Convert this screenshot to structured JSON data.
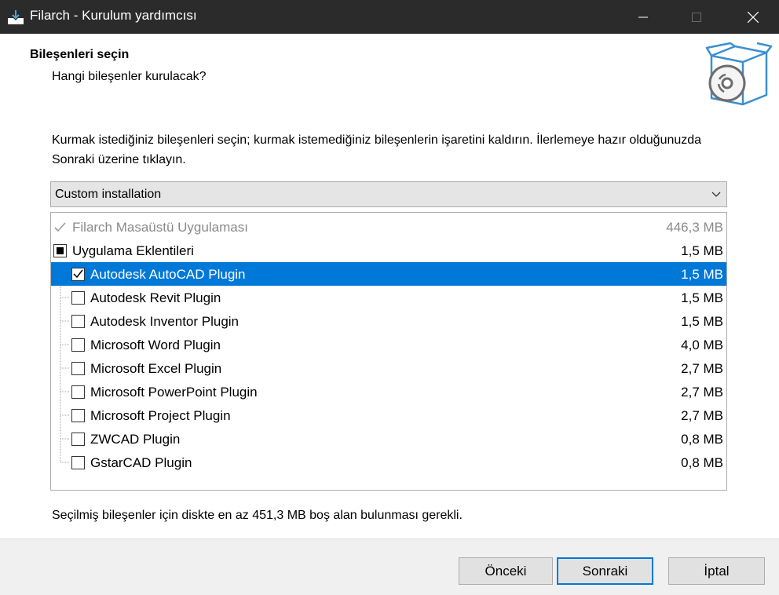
{
  "window": {
    "title": "Filarch - Kurulum yardımcısı"
  },
  "header": {
    "title": "Bileşenleri seçin",
    "subtitle": "Hangi bileşenler kurulacak?"
  },
  "description": "Kurmak istediğiniz bileşenleri seçin; kurmak istemediğiniz bileşenlerin işaretini kaldırın. İlerlemeye hazır olduğunuzda Sonraki üzerine tıklayın.",
  "install_type": {
    "selected": "Custom installation"
  },
  "components": [
    {
      "label": "Filarch Masaüstü Uygulaması",
      "size": "446,3 MB",
      "state": "checked-disabled"
    },
    {
      "label": "Uygulama Eklentileri",
      "size": "1,5 MB",
      "state": "partial"
    },
    {
      "label": "Autodesk AutoCAD Plugin",
      "size": "1,5 MB",
      "state": "checked"
    },
    {
      "label": "Autodesk Revit Plugin",
      "size": "1,5 MB",
      "state": "unchecked"
    },
    {
      "label": "Autodesk Inventor Plugin",
      "size": "1,5 MB",
      "state": "unchecked"
    },
    {
      "label": "Microsoft Word Plugin",
      "size": "4,0 MB",
      "state": "unchecked"
    },
    {
      "label": "Microsoft Excel Plugin",
      "size": "2,7 MB",
      "state": "unchecked"
    },
    {
      "label": "Microsoft PowerPoint Plugin",
      "size": "2,7 MB",
      "state": "unchecked"
    },
    {
      "label": "Microsoft Project Plugin",
      "size": "2,7 MB",
      "state": "unchecked"
    },
    {
      "label": "ZWCAD Plugin",
      "size": "0,8 MB",
      "state": "unchecked"
    },
    {
      "label": "GstarCAD Plugin",
      "size": "0,8 MB",
      "state": "unchecked"
    }
  ],
  "disk_requirement": "Seçilmiş bileşenler için diskte en az 451,3 MB boş alan bulunması gerekli.",
  "buttons": {
    "back": "Önceki",
    "next": "Sonraki",
    "cancel": "İptal"
  },
  "colors": {
    "selection": "#0078d7",
    "titlebar": "#2b2b2b"
  }
}
